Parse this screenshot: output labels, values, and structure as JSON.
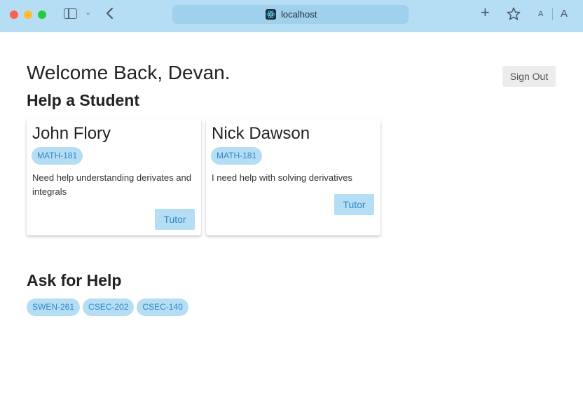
{
  "browser": {
    "address": "localhost",
    "icons": {
      "sidebar": "sidebar-toggle-icon",
      "back": "chevron-left-icon",
      "new_tab": "plus-icon",
      "bookmark": "star-icon",
      "text_small": "A",
      "text_large": "A"
    }
  },
  "page": {
    "welcome": "Welcome Back, Devan.",
    "sign_out": "Sign Out",
    "help_student_title": "Help a Student",
    "ask_help_title": "Ask for Help"
  },
  "requests": [
    {
      "name": "John Flory",
      "course": "MATH-181",
      "description": "Need help understanding derivates and integrals",
      "action": "Tutor"
    },
    {
      "name": "Nick Dawson",
      "course": "MATH-181",
      "description": "I need help with solving derivatives",
      "action": "Tutor"
    }
  ],
  "courses": [
    "SWEN-261",
    "CSEC-202",
    "CSEC-140"
  ],
  "colors": {
    "chrome": "#b5def4",
    "chip_bg": "#b5def4",
    "chip_text": "#2f86c8"
  }
}
